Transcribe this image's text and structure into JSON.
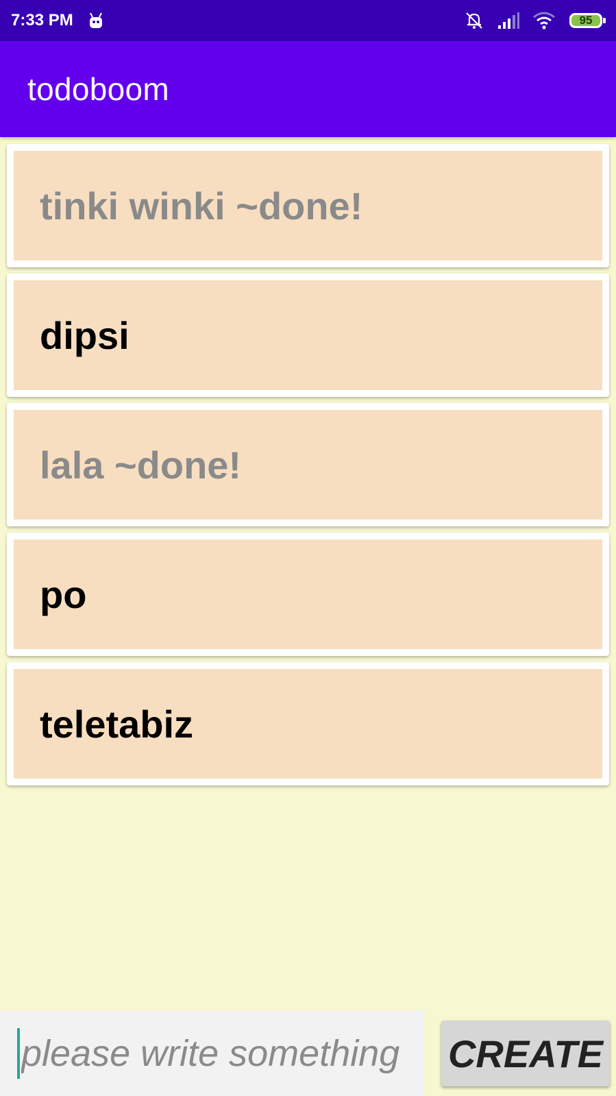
{
  "status_bar": {
    "time": "7:33 PM",
    "battery_level": "95",
    "icons": [
      "android-notification-icon",
      "bell-off-icon",
      "signal-icon",
      "wifi-icon",
      "battery-icon"
    ]
  },
  "app_bar": {
    "title": "todoboom"
  },
  "todos": [
    {
      "text": "tinki winki ~done!",
      "done": true
    },
    {
      "text": "dipsi",
      "done": false
    },
    {
      "text": "lala ~done!",
      "done": true
    },
    {
      "text": "po",
      "done": false
    },
    {
      "text": "teletabiz",
      "done": false
    }
  ],
  "input": {
    "placeholder": "please write something",
    "value": ""
  },
  "create_button": {
    "label": "CREATE"
  },
  "colors": {
    "status_bar": "#3700B3",
    "app_bar": "#6200EE",
    "background": "#F7F7D0",
    "card_fill": "#F8DEC0",
    "done_text": "#8A8A8A",
    "battery_fill": "#8BC34A"
  }
}
